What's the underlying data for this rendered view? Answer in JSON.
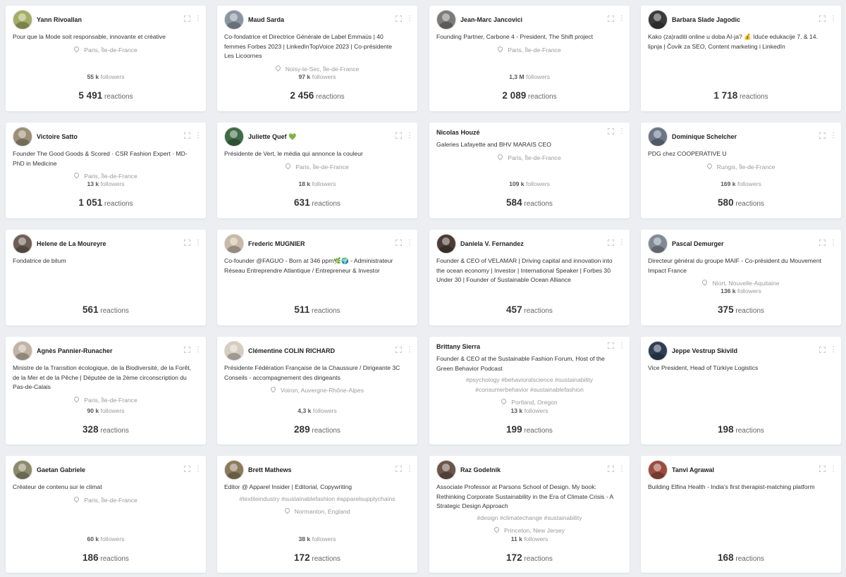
{
  "labels": {
    "followers": "followers",
    "reactions": "reactions"
  },
  "cards": [
    {
      "name": "Yann Rivoallan",
      "avatar_color": "#a4ae63",
      "headline": [
        "Pour que la Mode soit responsable, innovante et créative"
      ],
      "tags": [],
      "location": "Paris, Île-de-France",
      "followers": "55 k",
      "reactions": "5 491"
    },
    {
      "name": "Maud Sarda",
      "avatar_color": "#8a95a3",
      "headline": [
        "Co-fondatrice et Directrice Générale de Label Emmaüs | 40",
        "femmes Forbes 2023 | LinkedInTopVoice 2023 | Co-présidente",
        "Les Licoornes"
      ],
      "tags": [],
      "location": "Noisy-le-Sec, Île-de-France",
      "followers": "97 k",
      "reactions": "2 456"
    },
    {
      "name": "Jean-Marc Jancovici",
      "avatar_color": "#7d7a78",
      "headline": [
        "Founding Partner, Carbone 4 - President, The Shift project"
      ],
      "tags": [],
      "location": "Paris, Île-de-France",
      "followers": "1,3 M",
      "reactions": "2 089"
    },
    {
      "name": "Barbara Slade Jagodic",
      "avatar_color": "#3a3a3a",
      "headline": [
        "Kako (za)raditi online u doba AI-ja? 💰 Iduće edukacije 7. & 14.",
        "lipnja | Čovik za SEO, Content marketing i LinkedIn"
      ],
      "tags": [],
      "location": "",
      "followers": "",
      "reactions": "1 718"
    },
    {
      "name": "Victoire Satto",
      "avatar_color": "#9c8f76",
      "headline": [
        "Founder The Good Goods & Scored · CSR Fashion Expert · MD-",
        "PhD in Medicine"
      ],
      "tags": [],
      "location": "Paris, Île-de-France",
      "followers": "13 k",
      "reactions": "1 051"
    },
    {
      "name": "Juliette Quef 💚",
      "avatar_color": "#3f6b47",
      "headline": [
        "Présidente de Vert, le média qui annonce la couleur"
      ],
      "tags": [],
      "location": "Paris, Île-de-France",
      "followers": "18 k",
      "reactions": "631"
    },
    {
      "name": "Nicolas Houzé",
      "avatar_color": "",
      "headline": [
        "Galeries Lafayette and BHV MARAIS CEO"
      ],
      "tags": [],
      "location": "Paris, Île-de-France",
      "followers": "109 k",
      "reactions": "584"
    },
    {
      "name": "Dominique Schelcher",
      "avatar_color": "#6b7688",
      "headline": [
        "PDG chez COOPERATIVE U"
      ],
      "tags": [],
      "location": "Rungis, Île-de-France",
      "followers": "169 k",
      "reactions": "580"
    },
    {
      "name": "Helene de La Moureyre",
      "avatar_color": "#6d5f55",
      "headline": [
        "Fondatrice de bilum"
      ],
      "tags": [],
      "location": "",
      "followers": "",
      "reactions": "561"
    },
    {
      "name": "Frederic MUGNIER",
      "avatar_color": "#c9b9a6",
      "headline": [
        "Co-founder @FAGUO - Born at 346 ppm🌿🌍 - Administrateur",
        "Réseau Entreprendre Atlantique / Entrepreneur & Investor"
      ],
      "tags": [],
      "location": "",
      "followers": "",
      "reactions": "511"
    },
    {
      "name": "Daniela V. Fernandez",
      "avatar_color": "#4b3c35",
      "headline": [
        "Founder & CEO of VELAMAR | Driving capital and innovation into",
        "the ocean economy | Investor | International Speaker | Forbes 30",
        "Under 30 | Founder of Sustainable Ocean Alliance"
      ],
      "tags": [],
      "location": "",
      "followers": "",
      "reactions": "457"
    },
    {
      "name": "Pascal Demurger",
      "avatar_color": "#808a96",
      "headline": [
        "Directeur général du groupe MAIF - Co-président du Mouvement",
        "Impact France"
      ],
      "tags": [],
      "location": "Niort, Nouvelle-Aquitaine",
      "followers": "136 k",
      "reactions": "375"
    },
    {
      "name": "Agnès Pannier-Runacher",
      "avatar_color": "#c2b3a3",
      "headline": [
        "Ministre de la Transition écologique, de la Biodiversité, de la Forêt,",
        "de la Mer et de la Pêche | Députée de la 2ème circonscription du",
        "Pas-de-Calais"
      ],
      "tags": [],
      "location": "Paris, Île-de-France",
      "followers": "90 k",
      "reactions": "328"
    },
    {
      "name": "Clémentine COLIN RICHARD",
      "avatar_color": "#d6ccbf",
      "headline": [
        "Présidente Fédération Française de la Chaussure / Dirigeante 3C",
        "Conseils - accompagnement des dirigeants"
      ],
      "tags": [],
      "location": "Voiron, Auvergne-Rhône-Alpes",
      "followers": "4,3 k",
      "reactions": "289"
    },
    {
      "name": "Brittany Sierra",
      "avatar_color": "",
      "headline": [
        "Founder & CEO at the Sustainable Fashion Forum, Host of the",
        "Green Behavior Podcast"
      ],
      "tags": [
        "#psychology #behavioralscience #sustainability",
        "#consumerbehavior #sustainablefashion"
      ],
      "location": "Portland, Oregon",
      "followers": "13 k",
      "reactions": "199"
    },
    {
      "name": "Jeppe Vestrup Skivild",
      "avatar_color": "#2f3e55",
      "headline": [
        "Vice President, Head of Türkiye Logistics"
      ],
      "tags": [],
      "location": "",
      "followers": "",
      "reactions": "198"
    },
    {
      "name": "Gaetan Gabriele",
      "avatar_color": "#8d8a6a",
      "headline": [
        "Créateur de contenu sur le climat"
      ],
      "tags": [],
      "location": "Paris, Île-de-France",
      "followers": "60 k",
      "reactions": "186"
    },
    {
      "name": "Brett Mathews",
      "avatar_color": "#8c7a5c",
      "headline": [
        "Editor @ Apparel Insider | Editorial, Copywriting"
      ],
      "tags": [
        "#textileindustry #sustainablefashion #apparelsupplychains"
      ],
      "location": "Normanton, England",
      "followers": "38 k",
      "reactions": "172"
    },
    {
      "name": "Raz Godelnik",
      "avatar_color": "#6a5548",
      "headline": [
        "Associate Professor at Parsons School of Design. My book:",
        "Rethinking Corporate Sustainability in the Era of Climate Crisis - A",
        "Strategic Design Approach"
      ],
      "tags": [
        "#design #climatechange #sustainability"
      ],
      "location": "Princeton, New Jersey",
      "followers": "11 k",
      "reactions": "172"
    },
    {
      "name": "Tanvi Agrawal",
      "avatar_color": "#9a4c3d",
      "headline": [
        "Building Elfina Health - India's first therapist-matching platform"
      ],
      "tags": [],
      "location": "",
      "followers": "",
      "reactions": "168"
    }
  ]
}
